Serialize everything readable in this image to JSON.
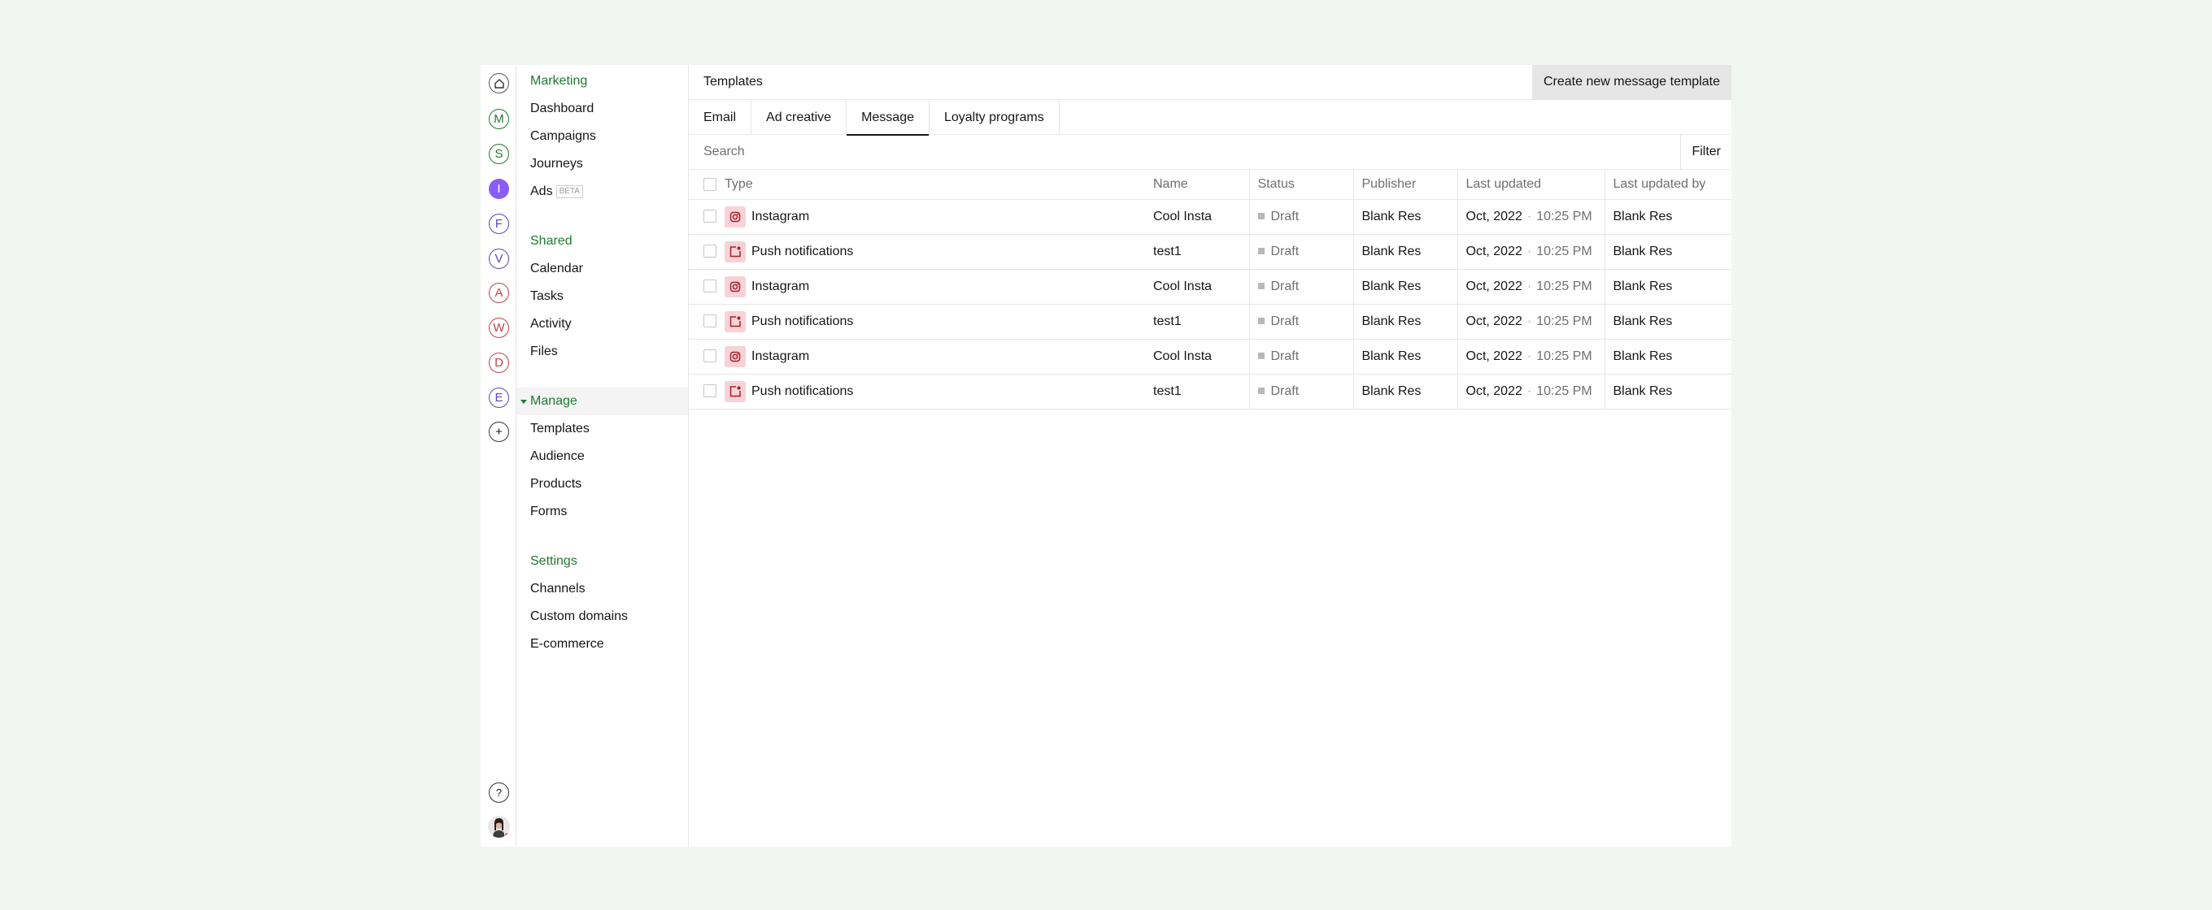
{
  "rail": {
    "items": [
      {
        "letter": "M",
        "color": "#1e7a2e",
        "filled": false
      },
      {
        "letter": "S",
        "color": "#1e7a2e",
        "filled": false
      },
      {
        "letter": "I",
        "color": "#8a5cf6",
        "filled": true
      },
      {
        "letter": "F",
        "color": "#5b48b8",
        "filled": false
      },
      {
        "letter": "V",
        "color": "#5b48b8",
        "filled": false
      },
      {
        "letter": "A",
        "color": "#c2414b",
        "filled": false
      },
      {
        "letter": "W",
        "color": "#c2414b",
        "filled": false
      },
      {
        "letter": "D",
        "color": "#c2414b",
        "filled": false
      },
      {
        "letter": "E",
        "color": "#5b48b8",
        "filled": false
      }
    ],
    "add_label": "+",
    "help_label": "?"
  },
  "sidebar": {
    "marketing": {
      "heading": "Marketing",
      "items": [
        "Dashboard",
        "Campaigns",
        "Journeys",
        "Ads"
      ],
      "beta": "BETA"
    },
    "shared": {
      "heading": "Shared",
      "items": [
        "Calendar",
        "Tasks",
        "Activity",
        "Files"
      ]
    },
    "manage": {
      "heading": "Manage",
      "items": [
        "Templates",
        "Audience",
        "Products",
        "Forms"
      ]
    },
    "settings": {
      "heading": "Settings",
      "items": [
        "Channels",
        "Custom domains",
        "E-commerce"
      ]
    }
  },
  "header": {
    "title": "Templates",
    "create_label": "Create new message template"
  },
  "tabs": [
    "Email",
    "Ad creative",
    "Message",
    "Loyalty programs"
  ],
  "active_tab": "Message",
  "search": {
    "placeholder": "Search",
    "filter_label": "Filter"
  },
  "table": {
    "columns": [
      "Type",
      "Name",
      "Status",
      "Publisher",
      "Last updated",
      "Last updated by"
    ],
    "rows": [
      {
        "type": "Instagram",
        "icon": "instagram-icon",
        "name": "Cool Insta",
        "status": "Draft",
        "publisher": "Blank Res",
        "date": "Oct, 2022",
        "time": "10:25 PM",
        "updated_by": "Blank Res"
      },
      {
        "type": "Push notifications",
        "icon": "push-notification-icon",
        "name": "test1",
        "status": "Draft",
        "publisher": "Blank Res",
        "date": "Oct, 2022",
        "time": "10:25 PM",
        "updated_by": "Blank Res"
      },
      {
        "type": "Instagram",
        "icon": "instagram-icon",
        "name": "Cool Insta",
        "status": "Draft",
        "publisher": "Blank Res",
        "date": "Oct, 2022",
        "time": "10:25 PM",
        "updated_by": "Blank Res"
      },
      {
        "type": "Push notifications",
        "icon": "push-notification-icon",
        "name": "test1",
        "status": "Draft",
        "publisher": "Blank Res",
        "date": "Oct, 2022",
        "time": "10:25 PM",
        "updated_by": "Blank Res"
      },
      {
        "type": "Instagram",
        "icon": "instagram-icon",
        "name": "Cool Insta",
        "status": "Draft",
        "publisher": "Blank Res",
        "date": "Oct, 2022",
        "time": "10:25 PM",
        "updated_by": "Blank Res"
      },
      {
        "type": "Push notifications",
        "icon": "push-notification-icon",
        "name": "test1",
        "status": "Draft",
        "publisher": "Blank Res",
        "date": "Oct, 2022",
        "time": "10:25 PM",
        "updated_by": "Blank Res"
      }
    ]
  },
  "colors": {
    "accent": "#1e7a2e",
    "icon_bg": "#f7d2d6",
    "icon_fg": "#a61e2c"
  }
}
